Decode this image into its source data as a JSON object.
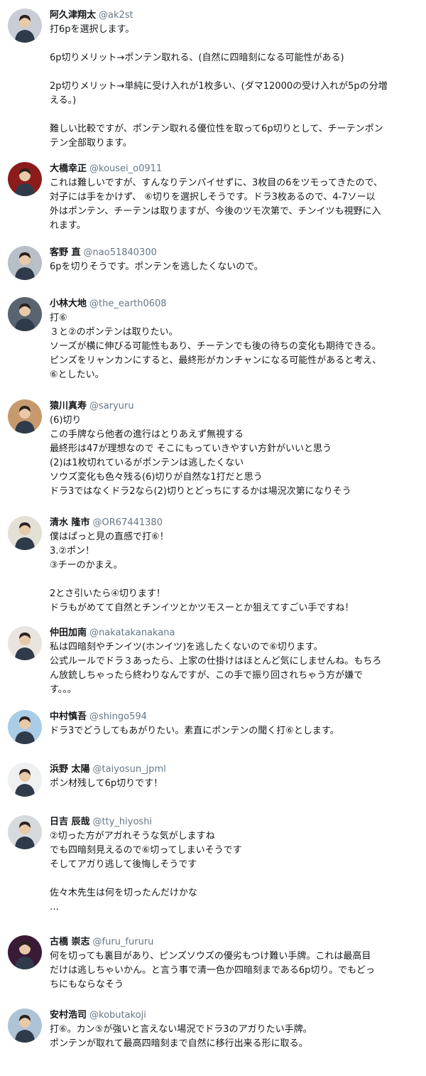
{
  "tweets": [
    {
      "name": "阿久津翔太",
      "handle": "@ak2st",
      "avatar_bg": "#c9ced6",
      "lines": [
        "打6pを選択します。",
        "",
        "6p切りメリット→ポンテン取れる、(自然に四暗刻になる可能性がある)",
        "",
        "2p切りメリット→単純に受け入れが1枚多い、(ダマ12000の受け入れが5pの分増",
        "える。)",
        "",
        "難しい比較ですが、ポンテン取れる優位性を取って6p切りとして、チーテンポン",
        "テン全部取ります。"
      ]
    },
    {
      "name": "大橋幸正",
      "handle": "@kousei_o0911",
      "avatar_bg": "#8c1c1c",
      "lines": [
        "これは難しいですが、すんなりテンパイせずに、3枚目の6をツモってきたので、",
        "対子には手をかけず、 ⑥切りを選択しそうです。ドラ3枚あるので、4-7ソー以",
        "外はポンテン、チーテンは取りますが、今後のツモ次第で、チンイツも視野に入",
        "れます。"
      ]
    },
    {
      "name": "客野 直",
      "handle": "@nao51840300",
      "avatar_bg": "#b9bfc6",
      "lines": [
        "6pを切りそうです。ポンテンを逃したくないので。"
      ]
    },
    {
      "name": "小林大地",
      "handle": "@the_earth0608",
      "avatar_bg": "#5a6470",
      "lines": [
        "打⑥",
        "３と②のポンテンは取りたい。",
        "ソーズが横に伸びる可能性もあり、チーテンでも後の待ちの変化も期待できる。",
        "ピンズをリャンカンにすると、最終形がカンチャンになる可能性があると考え、",
        "⑥としたい。"
      ]
    },
    {
      "name": "猿川真寿",
      "handle": "@saryuru",
      "avatar_bg": "#c79a6e",
      "lines": [
        "(6)切り",
        "この手牌なら他者の進行はとりあえず無視する",
        "最終形は47が理想なので そこにもっていきやすい方針がいいと思う",
        "(2)は1枚切れているがポンテンは逃したくない",
        "ソウズ変化も色々残る(6)切りが自然な1打だと思う",
        "ドラ3ではなくドラ2なら(2)切りとどっちにするかは場況次第になりそう"
      ]
    },
    {
      "name": "清水 隆市",
      "handle": "@OR67441380",
      "avatar_bg": "#e3e0d6",
      "lines": [
        "僕はぱっと見の直感で打⑥！",
        "3.②ポン！",
        "③チーのかまえ。",
        "",
        "2とさ引いたら④切ります！",
        "ドラもがめてて自然とチンイツとかツモスーとか狙えてすごい手ですね！"
      ]
    },
    {
      "name": "仲田加南",
      "handle": "@nakatakanakana",
      "avatar_bg": "#e9e4df",
      "lines": [
        "私は四暗刻やチンイツ(ホンイツ)を逃したくないので⑥切ります。",
        "公式ルールでドラ３あったら、上家の仕掛けはほとんど気にしませんね。もちろ",
        "ん放銃しちゃったら終わりなんですが、この手で振り回されちゃう方が嫌で",
        "す。。。"
      ]
    },
    {
      "name": "中村慎吾",
      "handle": "@shingo594",
      "avatar_bg": "#a9cde6",
      "lines": [
        "ドラ3でどうしてもあがりたい。素直にポンテンの聞く打⑥とします。"
      ]
    },
    {
      "name": "浜野 太陽",
      "handle": "@taiyosun_jpml",
      "avatar_bg": "#eef0f2",
      "lines": [
        "ポン材残して6p切りです！"
      ]
    },
    {
      "name": "日吉 辰哉",
      "handle": "@tty_hiyoshi",
      "avatar_bg": "#d7dadd",
      "lines": [
        "②切った方がアガれそうな気がしますね",
        "でも四暗刻見えるので⑥切ってしまいそうです",
        "そしてアガり逃して後悔しそうです",
        "",
        "佐々木先生は何を切ったんだけかな",
        "…"
      ]
    },
    {
      "name": "古橋 崇志",
      "handle": "@furu_fururu",
      "avatar_bg": "#3a1b35",
      "lines": [
        "何を切っても裏目があり、ピンズソウズの優劣もつけ難い手牌。これは最高目",
        "だけは逃しちゃいかん。と言う事で清一色か四暗刻まである6p切り。でもどっ",
        "ちにもならなそう"
      ]
    },
    {
      "name": "安村浩司",
      "handle": "@kobutakoji",
      "avatar_bg": "#aec3d6",
      "lines": [
        "打⑥。カン⑤が強いと言えない場況でドラ3のアガりたい手牌。",
        "ポンテンが取れて最高四暗刻まで自然に移行出来る形に取る。"
      ]
    }
  ]
}
